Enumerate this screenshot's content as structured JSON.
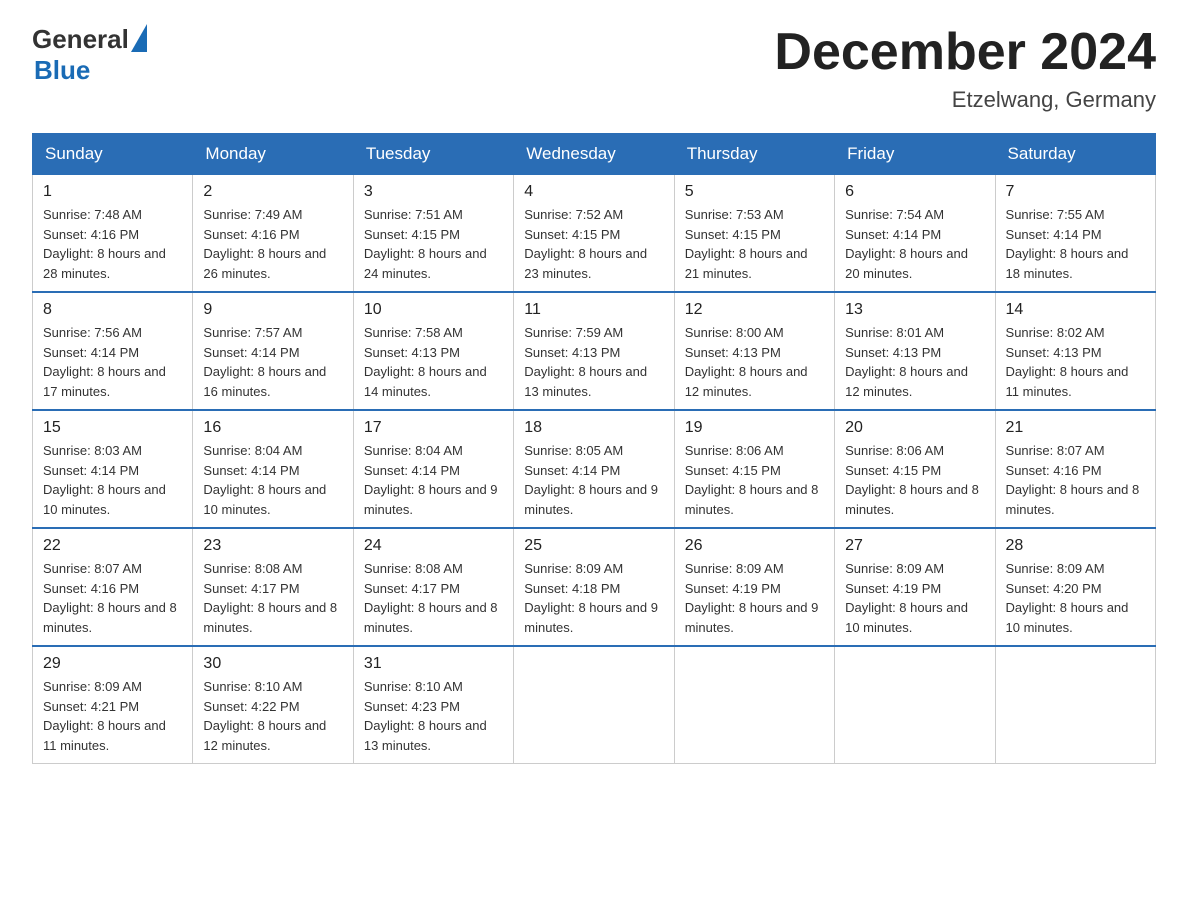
{
  "logo": {
    "general": "General",
    "blue": "Blue"
  },
  "header": {
    "title": "December 2024",
    "subtitle": "Etzelwang, Germany"
  },
  "weekdays": [
    "Sunday",
    "Monday",
    "Tuesday",
    "Wednesday",
    "Thursday",
    "Friday",
    "Saturday"
  ],
  "weeks": [
    [
      {
        "day": "1",
        "sunrise": "7:48 AM",
        "sunset": "4:16 PM",
        "daylight": "8 hours and 28 minutes."
      },
      {
        "day": "2",
        "sunrise": "7:49 AM",
        "sunset": "4:16 PM",
        "daylight": "8 hours and 26 minutes."
      },
      {
        "day": "3",
        "sunrise": "7:51 AM",
        "sunset": "4:15 PM",
        "daylight": "8 hours and 24 minutes."
      },
      {
        "day": "4",
        "sunrise": "7:52 AM",
        "sunset": "4:15 PM",
        "daylight": "8 hours and 23 minutes."
      },
      {
        "day": "5",
        "sunrise": "7:53 AM",
        "sunset": "4:15 PM",
        "daylight": "8 hours and 21 minutes."
      },
      {
        "day": "6",
        "sunrise": "7:54 AM",
        "sunset": "4:14 PM",
        "daylight": "8 hours and 20 minutes."
      },
      {
        "day": "7",
        "sunrise": "7:55 AM",
        "sunset": "4:14 PM",
        "daylight": "8 hours and 18 minutes."
      }
    ],
    [
      {
        "day": "8",
        "sunrise": "7:56 AM",
        "sunset": "4:14 PM",
        "daylight": "8 hours and 17 minutes."
      },
      {
        "day": "9",
        "sunrise": "7:57 AM",
        "sunset": "4:14 PM",
        "daylight": "8 hours and 16 minutes."
      },
      {
        "day": "10",
        "sunrise": "7:58 AM",
        "sunset": "4:13 PM",
        "daylight": "8 hours and 14 minutes."
      },
      {
        "day": "11",
        "sunrise": "7:59 AM",
        "sunset": "4:13 PM",
        "daylight": "8 hours and 13 minutes."
      },
      {
        "day": "12",
        "sunrise": "8:00 AM",
        "sunset": "4:13 PM",
        "daylight": "8 hours and 12 minutes."
      },
      {
        "day": "13",
        "sunrise": "8:01 AM",
        "sunset": "4:13 PM",
        "daylight": "8 hours and 12 minutes."
      },
      {
        "day": "14",
        "sunrise": "8:02 AM",
        "sunset": "4:13 PM",
        "daylight": "8 hours and 11 minutes."
      }
    ],
    [
      {
        "day": "15",
        "sunrise": "8:03 AM",
        "sunset": "4:14 PM",
        "daylight": "8 hours and 10 minutes."
      },
      {
        "day": "16",
        "sunrise": "8:04 AM",
        "sunset": "4:14 PM",
        "daylight": "8 hours and 10 minutes."
      },
      {
        "day": "17",
        "sunrise": "8:04 AM",
        "sunset": "4:14 PM",
        "daylight": "8 hours and 9 minutes."
      },
      {
        "day": "18",
        "sunrise": "8:05 AM",
        "sunset": "4:14 PM",
        "daylight": "8 hours and 9 minutes."
      },
      {
        "day": "19",
        "sunrise": "8:06 AM",
        "sunset": "4:15 PM",
        "daylight": "8 hours and 8 minutes."
      },
      {
        "day": "20",
        "sunrise": "8:06 AM",
        "sunset": "4:15 PM",
        "daylight": "8 hours and 8 minutes."
      },
      {
        "day": "21",
        "sunrise": "8:07 AM",
        "sunset": "4:16 PM",
        "daylight": "8 hours and 8 minutes."
      }
    ],
    [
      {
        "day": "22",
        "sunrise": "8:07 AM",
        "sunset": "4:16 PM",
        "daylight": "8 hours and 8 minutes."
      },
      {
        "day": "23",
        "sunrise": "8:08 AM",
        "sunset": "4:17 PM",
        "daylight": "8 hours and 8 minutes."
      },
      {
        "day": "24",
        "sunrise": "8:08 AM",
        "sunset": "4:17 PM",
        "daylight": "8 hours and 8 minutes."
      },
      {
        "day": "25",
        "sunrise": "8:09 AM",
        "sunset": "4:18 PM",
        "daylight": "8 hours and 9 minutes."
      },
      {
        "day": "26",
        "sunrise": "8:09 AM",
        "sunset": "4:19 PM",
        "daylight": "8 hours and 9 minutes."
      },
      {
        "day": "27",
        "sunrise": "8:09 AM",
        "sunset": "4:19 PM",
        "daylight": "8 hours and 10 minutes."
      },
      {
        "day": "28",
        "sunrise": "8:09 AM",
        "sunset": "4:20 PM",
        "daylight": "8 hours and 10 minutes."
      }
    ],
    [
      {
        "day": "29",
        "sunrise": "8:09 AM",
        "sunset": "4:21 PM",
        "daylight": "8 hours and 11 minutes."
      },
      {
        "day": "30",
        "sunrise": "8:10 AM",
        "sunset": "4:22 PM",
        "daylight": "8 hours and 12 minutes."
      },
      {
        "day": "31",
        "sunrise": "8:10 AM",
        "sunset": "4:23 PM",
        "daylight": "8 hours and 13 minutes."
      },
      null,
      null,
      null,
      null
    ]
  ]
}
